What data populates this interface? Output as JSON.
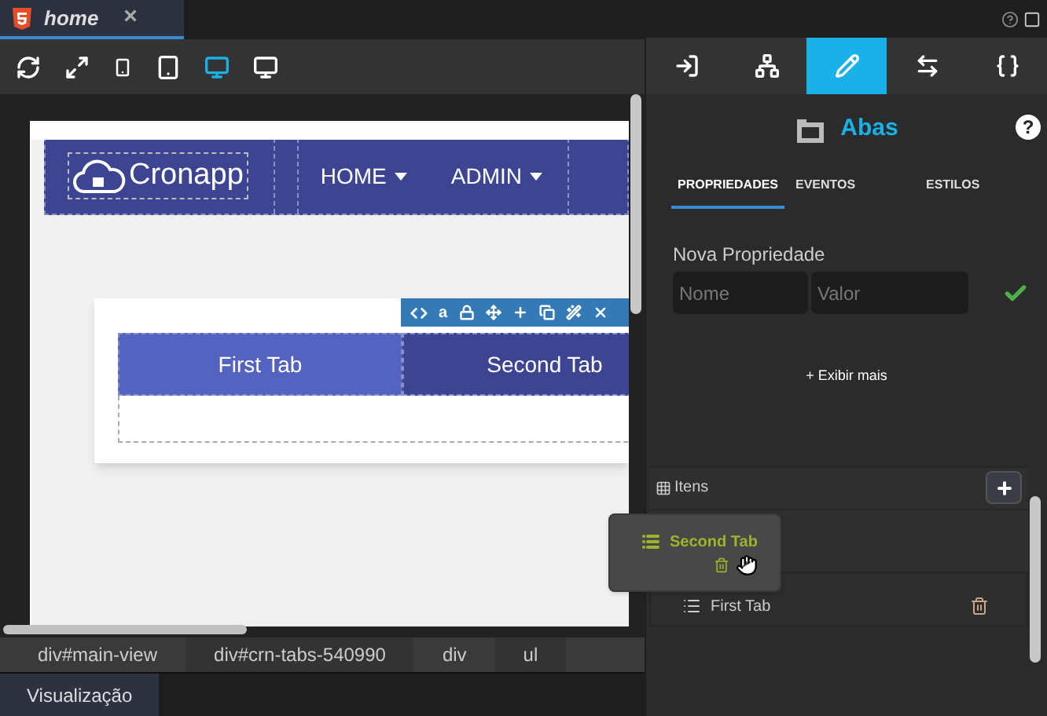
{
  "editor_tab": {
    "title": "home",
    "close": "×"
  },
  "devices": [
    {
      "kind": "refresh",
      "selected": false
    },
    {
      "kind": "expand",
      "selected": false
    },
    {
      "kind": "phone",
      "selected": false
    },
    {
      "kind": "tablet",
      "selected": false
    },
    {
      "kind": "desktop",
      "selected": true
    },
    {
      "kind": "monitor",
      "selected": false
    }
  ],
  "preview": {
    "brand": "Cronapp",
    "menu": [
      "HOME",
      "ADMIN"
    ],
    "tabs": [
      {
        "label": "First Tab",
        "selected": true
      },
      {
        "label": "Second Tab",
        "selected": false
      }
    ],
    "toolbar_text": "a"
  },
  "breadcrumb": [
    "div#main-view",
    "div#crn-tabs-540990",
    "div",
    "ul"
  ],
  "bottom_tab": "Visualização",
  "panel_tabs": [
    {
      "kind": "import",
      "selected": false
    },
    {
      "kind": "tree",
      "selected": false
    },
    {
      "kind": "edit",
      "selected": true
    },
    {
      "kind": "resize",
      "selected": false
    },
    {
      "kind": "code",
      "selected": false
    }
  ],
  "component": {
    "title": "Abas",
    "help": "?"
  },
  "sub_tabs": [
    {
      "label": "PROPRIEDADES",
      "selected": true
    },
    {
      "label": "EVENTOS",
      "selected": false
    },
    {
      "label": "ESTILOS",
      "selected": false
    }
  ],
  "new_property": {
    "label": "Nova Propriedade",
    "name_placeholder": "Nome",
    "value_placeholder": "Valor"
  },
  "show_more": "+ Exibir mais",
  "items": {
    "title": "Itens",
    "rows": [
      "First Tab"
    ]
  },
  "drag_ghost": {
    "label": "Second Tab"
  }
}
